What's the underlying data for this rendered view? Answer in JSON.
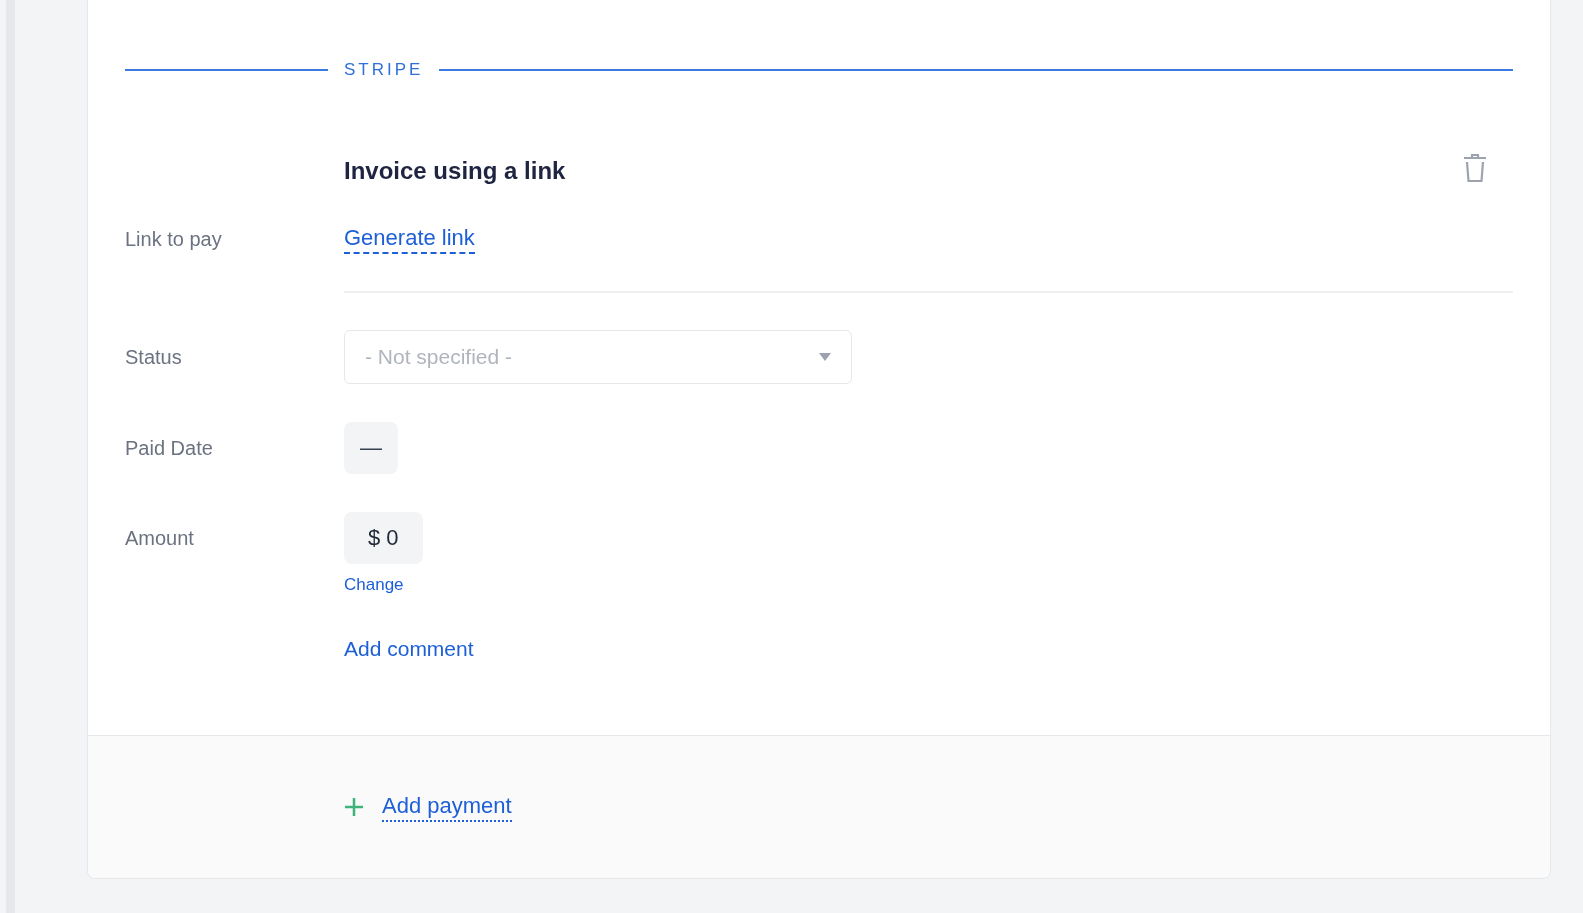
{
  "section": {
    "title": "STRIPE"
  },
  "payment": {
    "title": "Invoice using a link",
    "fields": [
      {
        "kind": "link",
        "label": "Link to pay",
        "value": "Generate link"
      },
      {
        "kind": "select",
        "label": "Status",
        "placeholder": "- Not specified -"
      },
      {
        "kind": "value",
        "label": "Paid Date",
        "value": "—"
      },
      {
        "kind": "amount",
        "label": "Amount",
        "value": "$ 0",
        "action": "Change"
      }
    ],
    "add_comment": "Add comment"
  },
  "footer": {
    "add_payment": "Add payment"
  }
}
